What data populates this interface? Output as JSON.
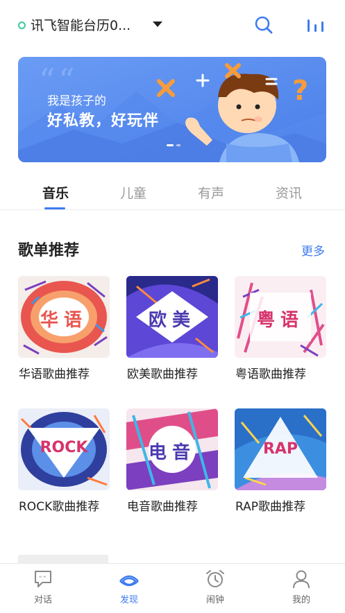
{
  "header": {
    "device_name": "讯飞智能台历0...",
    "status_color": "#3bc9a3",
    "icons": [
      "search-icon",
      "equalizer-icon"
    ]
  },
  "banner": {
    "line1": "我是孩子的",
    "line2": "好私教，好玩伴",
    "bg_color": "#5b8ff0"
  },
  "tabs": [
    {
      "label": "音乐",
      "active": true
    },
    {
      "label": "儿童",
      "active": false
    },
    {
      "label": "有声",
      "active": false
    },
    {
      "label": "资讯",
      "active": false
    }
  ],
  "playlist_section": {
    "title": "歌单推荐",
    "more": "更多",
    "cards": [
      {
        "cover_text": "华语",
        "label": "华语歌曲推荐"
      },
      {
        "cover_text": "欧美",
        "label": "欧美歌曲推荐"
      },
      {
        "cover_text": "粤语",
        "label": "粤语歌曲推荐"
      },
      {
        "cover_text": "ROCK",
        "label": "ROCK歌曲推荐"
      },
      {
        "cover_text": "电音",
        "label": "电音歌曲推荐"
      },
      {
        "cover_text": "RAP",
        "label": "RAP歌曲推荐"
      }
    ]
  },
  "bottom_nav": [
    {
      "label": "对话",
      "icon": "chat-icon",
      "active": false
    },
    {
      "label": "发现",
      "icon": "discover-icon",
      "active": true
    },
    {
      "label": "闹钟",
      "icon": "alarm-clock-icon",
      "active": false
    },
    {
      "label": "我的",
      "icon": "profile-icon",
      "active": false
    }
  ],
  "accent_color": "#3d7bf0"
}
